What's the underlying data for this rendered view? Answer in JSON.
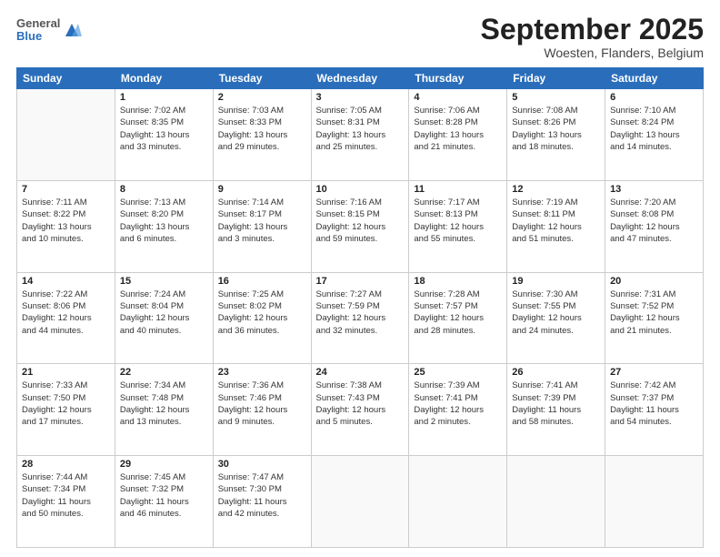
{
  "header": {
    "logo": {
      "general": "General",
      "blue": "Blue"
    },
    "title": "September 2025",
    "location": "Woesten, Flanders, Belgium"
  },
  "weekdays": [
    "Sunday",
    "Monday",
    "Tuesday",
    "Wednesday",
    "Thursday",
    "Friday",
    "Saturday"
  ],
  "weeks": [
    [
      {
        "day": "",
        "info": ""
      },
      {
        "day": "1",
        "info": "Sunrise: 7:02 AM\nSunset: 8:35 PM\nDaylight: 13 hours\nand 33 minutes."
      },
      {
        "day": "2",
        "info": "Sunrise: 7:03 AM\nSunset: 8:33 PM\nDaylight: 13 hours\nand 29 minutes."
      },
      {
        "day": "3",
        "info": "Sunrise: 7:05 AM\nSunset: 8:31 PM\nDaylight: 13 hours\nand 25 minutes."
      },
      {
        "day": "4",
        "info": "Sunrise: 7:06 AM\nSunset: 8:28 PM\nDaylight: 13 hours\nand 21 minutes."
      },
      {
        "day": "5",
        "info": "Sunrise: 7:08 AM\nSunset: 8:26 PM\nDaylight: 13 hours\nand 18 minutes."
      },
      {
        "day": "6",
        "info": "Sunrise: 7:10 AM\nSunset: 8:24 PM\nDaylight: 13 hours\nand 14 minutes."
      }
    ],
    [
      {
        "day": "7",
        "info": "Sunrise: 7:11 AM\nSunset: 8:22 PM\nDaylight: 13 hours\nand 10 minutes."
      },
      {
        "day": "8",
        "info": "Sunrise: 7:13 AM\nSunset: 8:20 PM\nDaylight: 13 hours\nand 6 minutes."
      },
      {
        "day": "9",
        "info": "Sunrise: 7:14 AM\nSunset: 8:17 PM\nDaylight: 13 hours\nand 3 minutes."
      },
      {
        "day": "10",
        "info": "Sunrise: 7:16 AM\nSunset: 8:15 PM\nDaylight: 12 hours\nand 59 minutes."
      },
      {
        "day": "11",
        "info": "Sunrise: 7:17 AM\nSunset: 8:13 PM\nDaylight: 12 hours\nand 55 minutes."
      },
      {
        "day": "12",
        "info": "Sunrise: 7:19 AM\nSunset: 8:11 PM\nDaylight: 12 hours\nand 51 minutes."
      },
      {
        "day": "13",
        "info": "Sunrise: 7:20 AM\nSunset: 8:08 PM\nDaylight: 12 hours\nand 47 minutes."
      }
    ],
    [
      {
        "day": "14",
        "info": "Sunrise: 7:22 AM\nSunset: 8:06 PM\nDaylight: 12 hours\nand 44 minutes."
      },
      {
        "day": "15",
        "info": "Sunrise: 7:24 AM\nSunset: 8:04 PM\nDaylight: 12 hours\nand 40 minutes."
      },
      {
        "day": "16",
        "info": "Sunrise: 7:25 AM\nSunset: 8:02 PM\nDaylight: 12 hours\nand 36 minutes."
      },
      {
        "day": "17",
        "info": "Sunrise: 7:27 AM\nSunset: 7:59 PM\nDaylight: 12 hours\nand 32 minutes."
      },
      {
        "day": "18",
        "info": "Sunrise: 7:28 AM\nSunset: 7:57 PM\nDaylight: 12 hours\nand 28 minutes."
      },
      {
        "day": "19",
        "info": "Sunrise: 7:30 AM\nSunset: 7:55 PM\nDaylight: 12 hours\nand 24 minutes."
      },
      {
        "day": "20",
        "info": "Sunrise: 7:31 AM\nSunset: 7:52 PM\nDaylight: 12 hours\nand 21 minutes."
      }
    ],
    [
      {
        "day": "21",
        "info": "Sunrise: 7:33 AM\nSunset: 7:50 PM\nDaylight: 12 hours\nand 17 minutes."
      },
      {
        "day": "22",
        "info": "Sunrise: 7:34 AM\nSunset: 7:48 PM\nDaylight: 12 hours\nand 13 minutes."
      },
      {
        "day": "23",
        "info": "Sunrise: 7:36 AM\nSunset: 7:46 PM\nDaylight: 12 hours\nand 9 minutes."
      },
      {
        "day": "24",
        "info": "Sunrise: 7:38 AM\nSunset: 7:43 PM\nDaylight: 12 hours\nand 5 minutes."
      },
      {
        "day": "25",
        "info": "Sunrise: 7:39 AM\nSunset: 7:41 PM\nDaylight: 12 hours\nand 2 minutes."
      },
      {
        "day": "26",
        "info": "Sunrise: 7:41 AM\nSunset: 7:39 PM\nDaylight: 11 hours\nand 58 minutes."
      },
      {
        "day": "27",
        "info": "Sunrise: 7:42 AM\nSunset: 7:37 PM\nDaylight: 11 hours\nand 54 minutes."
      }
    ],
    [
      {
        "day": "28",
        "info": "Sunrise: 7:44 AM\nSunset: 7:34 PM\nDaylight: 11 hours\nand 50 minutes."
      },
      {
        "day": "29",
        "info": "Sunrise: 7:45 AM\nSunset: 7:32 PM\nDaylight: 11 hours\nand 46 minutes."
      },
      {
        "day": "30",
        "info": "Sunrise: 7:47 AM\nSunset: 7:30 PM\nDaylight: 11 hours\nand 42 minutes."
      },
      {
        "day": "",
        "info": ""
      },
      {
        "day": "",
        "info": ""
      },
      {
        "day": "",
        "info": ""
      },
      {
        "day": "",
        "info": ""
      }
    ]
  ]
}
